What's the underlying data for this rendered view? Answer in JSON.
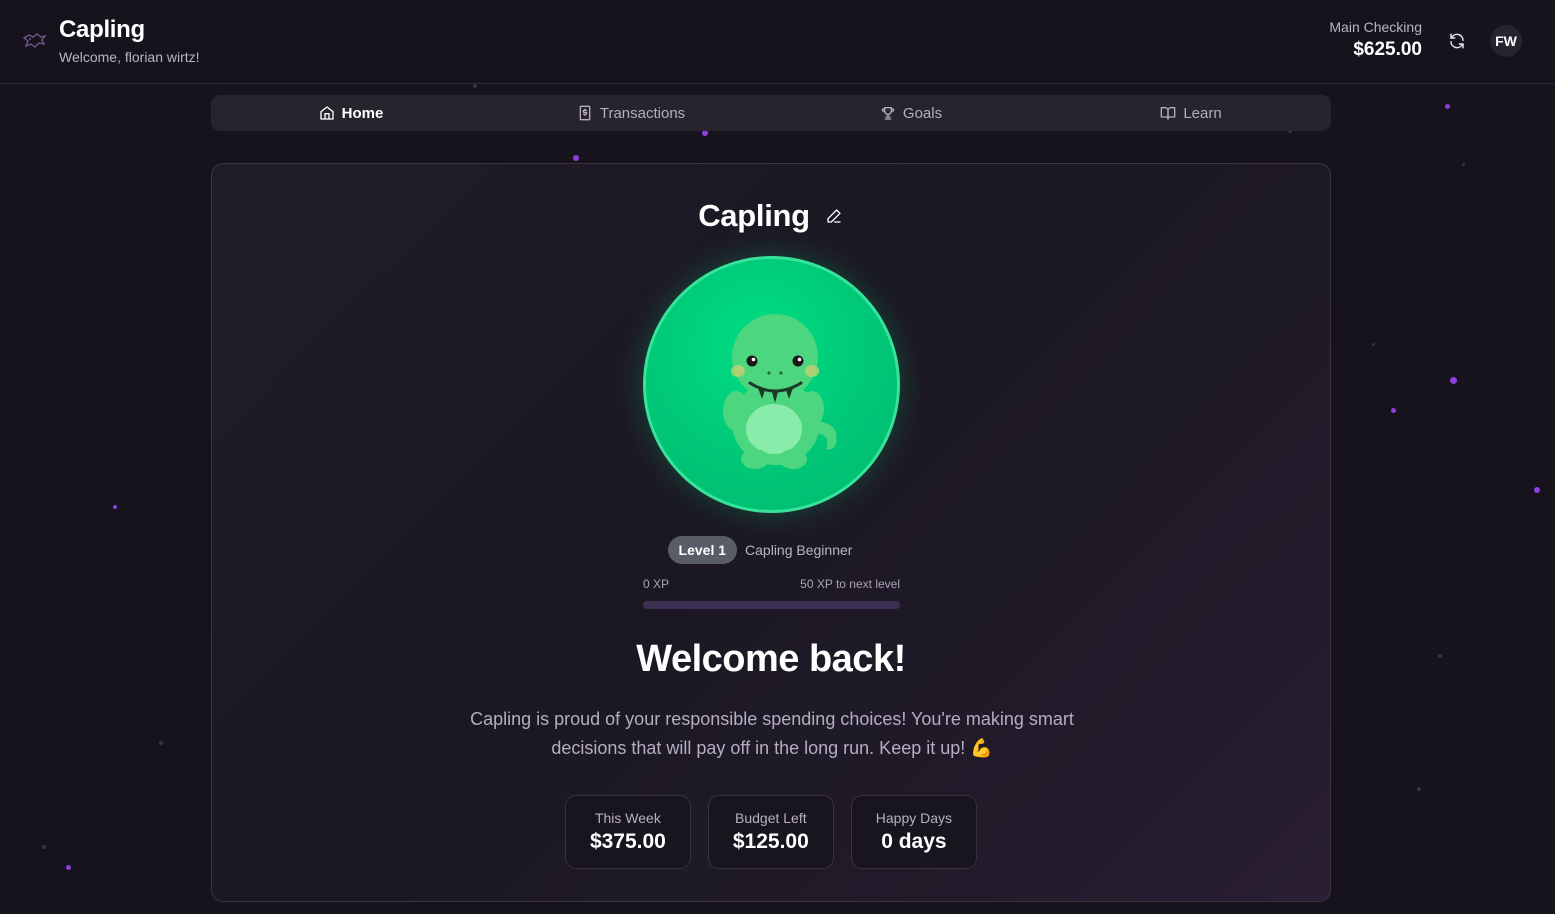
{
  "app": {
    "title": "Capling",
    "welcome": "Welcome, florian wirtz!"
  },
  "account": {
    "label": "Main Checking",
    "balance": "$625.00"
  },
  "user": {
    "initials": "FW"
  },
  "tabs": [
    {
      "label": "Home",
      "icon": "home-icon",
      "active": true
    },
    {
      "label": "Transactions",
      "icon": "receipt-icon",
      "active": false
    },
    {
      "label": "Goals",
      "icon": "trophy-icon",
      "active": false
    },
    {
      "label": "Learn",
      "icon": "book-icon",
      "active": false
    }
  ],
  "pet": {
    "name": "Capling",
    "level_badge": "Level 1",
    "level_title": "Capling Beginner",
    "xp_current": "0 XP",
    "xp_next": "50 XP to next level",
    "xp_progress": 0
  },
  "main": {
    "heading": "Welcome back!",
    "message": "Capling is proud of your responsible spending choices! You're making smart decisions that will pay off in the long run. Keep it up! 💪"
  },
  "stats": [
    {
      "label": "This Week",
      "value": "$375.00"
    },
    {
      "label": "Budget Left",
      "value": "$125.00"
    },
    {
      "label": "Happy Days",
      "value": "0 days"
    }
  ],
  "colors": {
    "accent": "#8b3fe0",
    "pet_green": "#00c777",
    "background": "#16131d"
  }
}
